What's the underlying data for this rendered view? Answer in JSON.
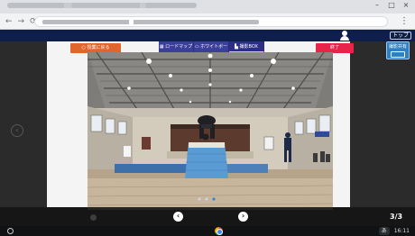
{
  "window_controls": [
    "–",
    "□",
    "×"
  ],
  "browser_nav": [
    "←",
    "→",
    "⟳"
  ],
  "browser_menu_icon": "kebab-menu-icon",
  "header": {
    "top_button": "トップ"
  },
  "toolbar": {
    "left_button": "○ 授業に戻る",
    "tabs": [
      {
        "label": "▦ ロードマップ",
        "active": false
      },
      {
        "label": "▭ ホワイトボード",
        "active": false
      },
      {
        "label": "▙ 撮影BOX",
        "active": true
      }
    ],
    "end_button": "終了"
  },
  "side_panel_button": "撮影共有",
  "viewer": {
    "page_counter": "3/3",
    "prev_symbol": "‹",
    "next_symbol": "›",
    "dots": 3,
    "current_dot": 3
  },
  "shelf": {
    "ime": "あ",
    "time": "16:11"
  },
  "colors": {
    "app_bar": "#0d1f4a",
    "orange": "#e0662e",
    "tab_blue": "#3b3f9b",
    "pink": "#e8244b",
    "side_blue": "#2f7fc2"
  }
}
